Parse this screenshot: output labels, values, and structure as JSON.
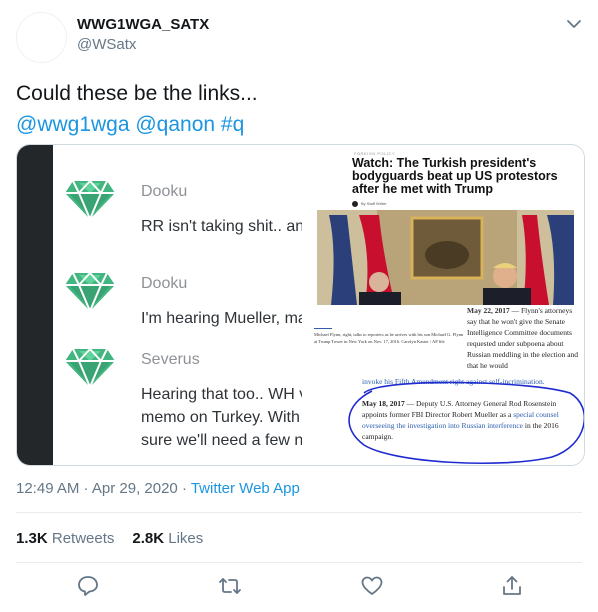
{
  "author": {
    "display_name": "WWG1WGA_SATX",
    "handle": "@WSatx"
  },
  "tweet": {
    "text_line1": "Could these be the links...",
    "hashtags_line": "@wwg1wga @qanon #q",
    "timestamp": "12:49 AM · Apr 29, 2020 · ",
    "client": "Twitter Web App"
  },
  "stats": {
    "retweets_count": "1.3K",
    "retweets_label": "Retweets",
    "likes_count": "2.8K",
    "likes_label": "Likes"
  },
  "actions": [
    {
      "icon": "reply-icon"
    },
    {
      "icon": "retweet-icon"
    },
    {
      "icon": "like-icon"
    },
    {
      "icon": "share-icon"
    }
  ],
  "media": {
    "chat": {
      "messages": [
        {
          "author": "Dooku",
          "body": "RR isn't taking shit.. an"
        },
        {
          "author": "Dooku",
          "body": "I'm hearing Mueller, ma"
        },
        {
          "author": "Severus",
          "body_1": "Hearing that too.. WH v",
          "body_2": "memo on Turkey. With",
          "body_3": "sure we'll need a few n"
        }
      ]
    },
    "news": {
      "kicker": "FOREIGN POLICY",
      "headline": "Watch: The Turkish president's bodyguards beat up US protestors after he met with Trump",
      "byline": "By Staff Writer",
      "caption": "Michael Flynn, right, talks to reporters as he arrives with his son Michael G. Flynn at Trump Tower in New York on Nov. 17, 2016.",
      "caption_credit": "Carolyn Kaster / AP file",
      "date_1": "May 22, 2017",
      "text_1": " — Flynn's attorneys say that he won't give the Senate Intelligence Committee documents requested under subpoena about Russian meddling in the election and that he would",
      "link_1": "invoke his Fifth Amendment right against self-incrimination.",
      "date_2": "May 18, 2017",
      "text_2a": " — Deputy U.S. Attorney General Rod Rosenstein appoints former FBI Director Robert Mueller as a ",
      "link_2": "special counsel overseeing the investigation into Russian interference",
      "text_2b": " in the 2016 campaign."
    }
  },
  "colors": {
    "accent": "#1b95e0",
    "gem": "#43b581",
    "chat_sidebar": "#23272a",
    "circle_ink": "#1f2bd0"
  }
}
